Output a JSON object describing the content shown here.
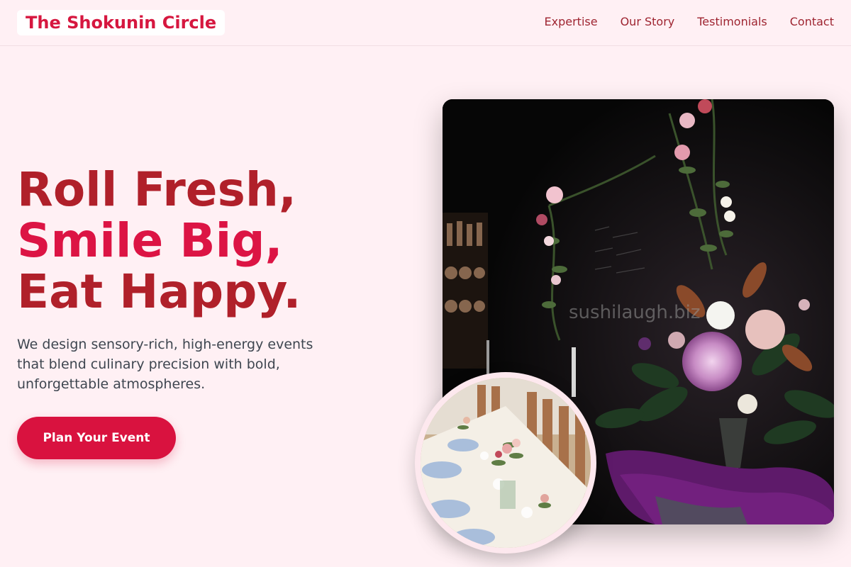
{
  "brand": {
    "name": "The Shokunin Circle"
  },
  "nav": {
    "items": [
      {
        "label": "Expertise"
      },
      {
        "label": "Our Story"
      },
      {
        "label": "Testimonials"
      },
      {
        "label": "Contact"
      }
    ]
  },
  "hero": {
    "title_line1": "Roll Fresh,",
    "title_line2": "Smile Big,",
    "title_line3": "Eat Happy.",
    "subtitle": "We design sensory-rich, high-energy events that blend culinary precision with bold, unforgettable atmospheres.",
    "cta_label": "Plan Your Event"
  },
  "images": {
    "main_watermark": "sushilaugh.biz"
  },
  "colors": {
    "background": "#fff0f4",
    "brand": "#d6173f",
    "heading_dark": "#b0202a",
    "heading_accent": "#dc1444",
    "cta": "#d9123f"
  }
}
